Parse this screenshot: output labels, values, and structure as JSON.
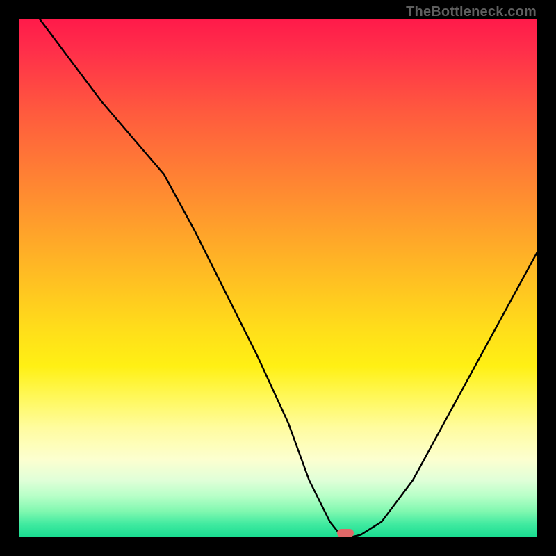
{
  "watermark": "TheBottleneck.com",
  "chart_data": {
    "type": "line",
    "title": "",
    "xlabel": "",
    "ylabel": "",
    "xlim": [
      0,
      100
    ],
    "ylim": [
      0,
      100
    ],
    "grid": false,
    "legend": false,
    "series": [
      {
        "name": "bottleneck-curve",
        "x": [
          4,
          10,
          16,
          22,
          28,
          34,
          40,
          46,
          52,
          56,
          60,
          62,
          64,
          66,
          70,
          76,
          82,
          88,
          94,
          100
        ],
        "y": [
          100,
          92,
          84,
          77,
          70,
          59,
          47,
          35,
          22,
          11,
          3,
          0.5,
          0,
          0.5,
          3,
          11,
          22,
          33,
          44,
          55
        ]
      }
    ],
    "marker": {
      "x": 63,
      "y": 0.8,
      "color": "#e06868"
    },
    "background": {
      "type": "vertical-gradient",
      "stops": [
        {
          "pos": 0,
          "color": "#ff1a4a"
        },
        {
          "pos": 50,
          "color": "#ffc820"
        },
        {
          "pos": 80,
          "color": "#fffca0"
        },
        {
          "pos": 100,
          "color": "#18dc90"
        }
      ]
    }
  },
  "colors": {
    "frame": "#000000",
    "curve": "#000000",
    "marker": "#e06868",
    "watermark": "#5f5f5f"
  }
}
